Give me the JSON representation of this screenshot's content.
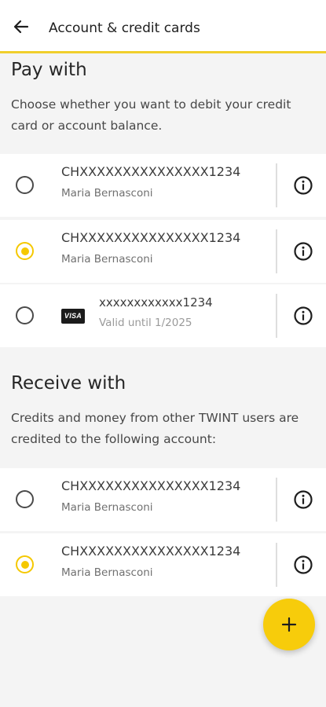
{
  "header": {
    "title": "Account & credit cards",
    "back_icon": "arrow-left-icon"
  },
  "pay_section": {
    "title": "Pay with",
    "description": "Choose whether you want to debit your credit card or account balance."
  },
  "pay_items": [
    {
      "number": "CHXXXXXXXXXXXXXXX1234",
      "sub": "Maria Bernasconi",
      "selected": false
    },
    {
      "number": "CHXXXXXXXXXXXXXXX1234",
      "sub": "Maria Bernasconi",
      "selected": true
    },
    {
      "number": "xxxxxxxxxxxx1234",
      "sub": "Valid until 1/2025",
      "selected": false,
      "logo": "VISA"
    }
  ],
  "receive_section": {
    "title": "Receive with",
    "description": "Credits and money from other TWINT users are credited to the following account:"
  },
  "receive_items": [
    {
      "number": "CHXXXXXXXXXXXXXXX1234",
      "sub": "Maria Bernasconi",
      "selected": false
    },
    {
      "number": "CHXXXXXXXXXXXXXXX1234",
      "sub": "Maria Bernasconi",
      "selected": true
    }
  ],
  "fab": {
    "icon": "plus-icon"
  },
  "colors": {
    "accent": "#f7cc0b",
    "header_underline": "#f0cf2c",
    "background": "#f4f4f4"
  }
}
